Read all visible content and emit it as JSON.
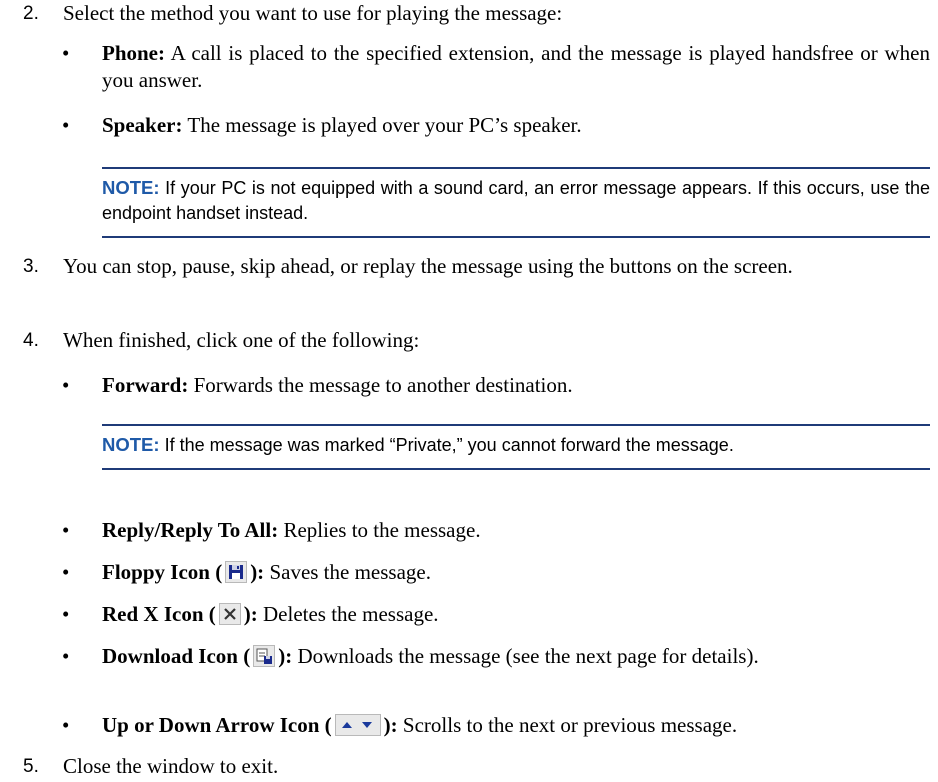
{
  "steps": {
    "s2": {
      "num": "2.",
      "text": "Select the method you want to use for playing the message:"
    },
    "s3": {
      "num": "3.",
      "text": "You can stop, pause, skip ahead, or replay the message using the buttons on the screen."
    },
    "s4": {
      "num": "4.",
      "text": "When finished, click one of the following:"
    },
    "s5": {
      "num": "5.",
      "text": "Close the window to exit."
    }
  },
  "play_methods": [
    {
      "term": "Phone:",
      "desc": " A call is placed to the specified extension, and the message is played handsfree or when you answer."
    },
    {
      "term": "Speaker:",
      "desc": " The message is played over your PC’s speaker."
    }
  ],
  "notes": {
    "sound": {
      "tag": "NOTE:",
      "text": " If your PC is not equipped with a sound card, an error message appears. If this occurs, use the endpoint handset instead."
    },
    "private": {
      "tag": "NOTE:",
      "text": " If the message was marked “Private,” you cannot forward the message."
    }
  },
  "actions": [
    {
      "term": "Forward:",
      "desc": " Forwards the message to another destination."
    },
    {
      "term": "Reply/Reply To All:",
      "desc": " Replies to the message."
    },
    {
      "term": "Floppy Icon (",
      "term_end": "):",
      "desc": " Saves the message.",
      "icon": "floppy-icon"
    },
    {
      "term": "Red X Icon (",
      "term_end": "):",
      "desc": " Deletes the message.",
      "icon": "red-x-icon"
    },
    {
      "term": "Download Icon (",
      "term_end": "):",
      "desc": " Downloads the message (see the next page for details).",
      "icon": "download-icon"
    },
    {
      "term": "Up or Down Arrow Icon (",
      "term_end": "):",
      "desc": " Scrolls to the next or previous message.",
      "icon": "up-down-arrow-icon"
    }
  ],
  "colors": {
    "note_tag": "#1f5aa8",
    "rule": "#1f3b78"
  }
}
